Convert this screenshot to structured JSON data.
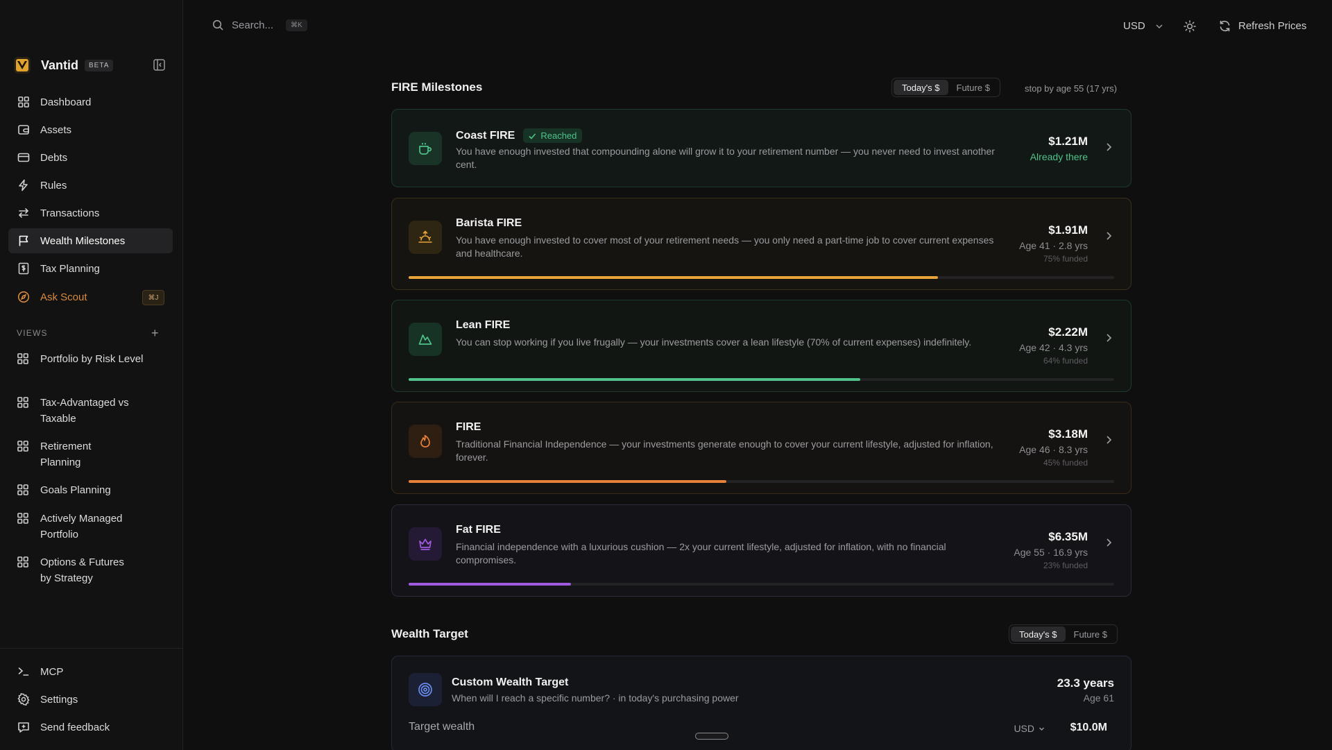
{
  "sidebar": {
    "brand": {
      "name": "Vantid",
      "badge": "BETA"
    },
    "nav": [
      {
        "label": "Dashboard",
        "icon": "dashboard-icon"
      },
      {
        "label": "Assets",
        "icon": "wallet-icon"
      },
      {
        "label": "Debts",
        "icon": "credit-card-icon"
      },
      {
        "label": "Rules",
        "icon": "lightning-icon"
      },
      {
        "label": "Transactions",
        "icon": "arrows-exchange-icon"
      },
      {
        "label": "Wealth Milestones",
        "icon": "flag-icon",
        "active": true
      },
      {
        "label": "Tax Planning",
        "icon": "dollar-receipt-icon"
      }
    ],
    "scout": {
      "label": "Ask Scout",
      "shortcut": "⌘J",
      "icon": "compass-icon"
    },
    "views_header": "VIEWS",
    "views": [
      {
        "label": "Portfolio by Risk Level"
      },
      {
        "label": "Tax-Advantaged vs Taxable"
      },
      {
        "label": "Retirement Planning"
      },
      {
        "label": "Goals Planning"
      },
      {
        "label": "Actively Managed Portfolio"
      },
      {
        "label": "Options & Futures by Strategy"
      }
    ],
    "footer": [
      {
        "label": "MCP",
        "icon": "terminal-icon"
      },
      {
        "label": "Settings",
        "icon": "gear-icon"
      },
      {
        "label": "Send feedback",
        "icon": "feedback-icon"
      }
    ]
  },
  "topbar": {
    "search_placeholder": "Search...",
    "search_shortcut": "⌘K",
    "currency": "USD",
    "refresh_label": "Refresh Prices"
  },
  "fire": {
    "title": "FIRE Milestones",
    "toggle": {
      "today": "Today's $",
      "future": "Future $"
    },
    "stop_note": "stop by age 55 (17 yrs)",
    "cards": [
      {
        "title": "Coast FIRE",
        "badge": "Reached",
        "desc": "You have enough invested that compounding alone will grow it to your retirement number — you never need to invest another cent.",
        "amount": "$1.21M",
        "sub": "Already there",
        "accent": "#4fc38a"
      },
      {
        "title": "Barista FIRE",
        "desc": "You have enough invested to cover most of your retirement needs — you only need a part-time job to cover current expenses and healthcare.",
        "amount": "$1.91M",
        "sub": "Age 41 · 2.8 yrs",
        "funded": "75% funded",
        "progress": 0.75,
        "accent": "#e8a33a"
      },
      {
        "title": "Lean FIRE",
        "desc": "You can stop working if you live frugally — your investments cover a lean lifestyle (70% of current expenses) indefinitely.",
        "amount": "$2.22M",
        "sub": "Age 42 · 4.3 yrs",
        "funded": "64% funded",
        "progress": 0.64,
        "accent": "#4fc38a"
      },
      {
        "title": "FIRE",
        "desc": "Traditional Financial Independence — your investments generate enough to cover your current lifestyle, adjusted for inflation, forever.",
        "amount": "$3.18M",
        "sub": "Age 46 · 8.3 yrs",
        "funded": "45% funded",
        "progress": 0.45,
        "accent": "#e8803a"
      },
      {
        "title": "Fat FIRE",
        "desc": "Financial independence with a luxurious cushion — 2x your current lifestyle, adjusted for inflation, with no financial compromises.",
        "amount": "$6.35M",
        "sub": "Age 55 · 16.9 yrs",
        "funded": "23% funded",
        "progress": 0.23,
        "accent": "#a05ae0"
      }
    ]
  },
  "wealth_target": {
    "title": "Wealth Target",
    "toggle": {
      "today": "Today's $",
      "future": "Future $"
    },
    "card": {
      "title": "Custom Wealth Target",
      "desc": "When will I reach a specific number? · in today's purchasing power",
      "years": "23.3 years",
      "age": "Age 61",
      "target_label": "Target wealth",
      "currency": "USD",
      "value": "$10.0M"
    }
  }
}
